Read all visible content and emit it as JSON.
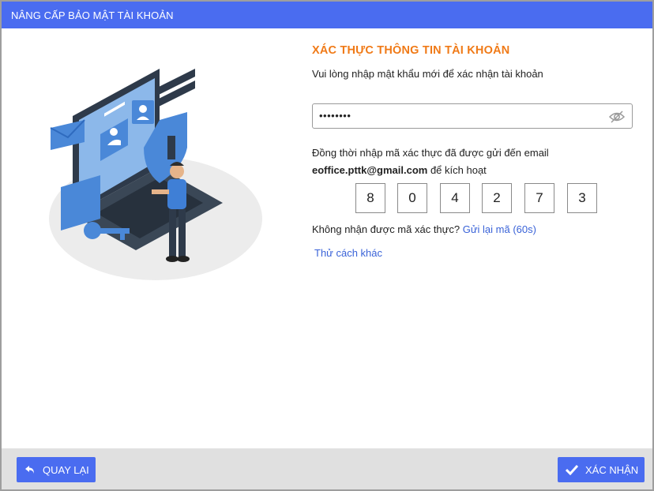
{
  "header": {
    "title": "NÂNG CẤP BẢO MẬT TÀI KHOẢN"
  },
  "main": {
    "title": "XÁC THỰC THÔNG TIN TÀI KHOẢN",
    "subtitle": "Vui lòng nhập mật khẩu mới để xác nhận tài khoản",
    "password": {
      "value": "••••••••",
      "toggle_icon": "eye-hidden-icon"
    },
    "otp_prompt": "Đồng thời nhập mã xác thực đã được gửi đến email",
    "email": "eoffice.pttk@gmail.com",
    "otp_suffix": "để kích hoạt",
    "otp_digits": [
      "8",
      "0",
      "4",
      "2",
      "7",
      "3"
    ],
    "resend_question": "Không nhận được mã xác thực?",
    "resend_link": "Gửi lại mã (60s)",
    "other_method": "Thử cách khác"
  },
  "footer": {
    "back_label": "QUAY LẠI",
    "confirm_label": "XÁC NHẬN"
  },
  "colors": {
    "primary": "#4a6cf0",
    "accent_title": "#f07a17",
    "link": "#3a63d8",
    "footer_bg": "#e0e0e0"
  }
}
